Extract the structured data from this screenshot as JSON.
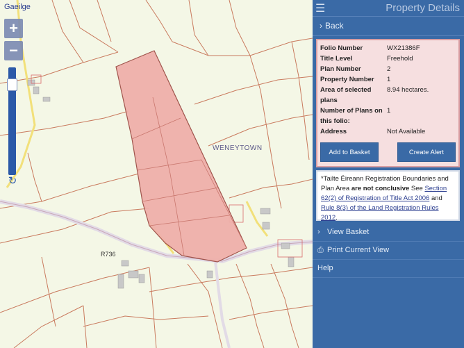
{
  "map": {
    "language_link": "Gaeilge",
    "zoom_in": "+",
    "zoom_out": "−",
    "reset_icon": "↻",
    "place_label": "WENEYTOWN",
    "road_label": "R736",
    "colors": {
      "background": "#f4f7e6",
      "parcel_fill": "#efb0aa",
      "boundary": "#c97a5e",
      "roads": "#e6e2ea",
      "minor_road": "#f2e07a"
    }
  },
  "panel": {
    "title": "Property Details",
    "menu_icon": "hamburger-icon",
    "back_label": "Back",
    "back_icon": "chevron-right-icon",
    "details": [
      {
        "label": "Folio Number",
        "value": "WX21386F"
      },
      {
        "label": "Title Level",
        "value": "Freehold"
      },
      {
        "label": "Plan Number",
        "value": "2"
      },
      {
        "label": "Property Number",
        "value": "1"
      },
      {
        "label": "Area of selected plans",
        "value": "8.94 hectares."
      },
      {
        "label": "Number of Plans on this folio:",
        "value": "1"
      },
      {
        "label": "Address",
        "value": "Not Available"
      }
    ],
    "add_to_basket": "Add to Basket",
    "create_alert": "Create Alert",
    "disclaimer": {
      "prefix": "*Tailte Éireann Registration Boundaries and Plan Area",
      "bold": "are not conclusive",
      "see": "See",
      "link1": "Section 62(2) of Registration of Title Act 2006",
      "and": "and",
      "link2": "Rule 8(3) of the Land Registration Rules 2012",
      "end": "."
    },
    "menu": [
      {
        "label": "View Basket",
        "icon": "chevron-right-icon",
        "glyph": "›"
      },
      {
        "label": "Print Current View",
        "icon": "print-icon",
        "glyph": "⎙"
      },
      {
        "label": "Help",
        "icon": "",
        "glyph": ""
      }
    ]
  }
}
